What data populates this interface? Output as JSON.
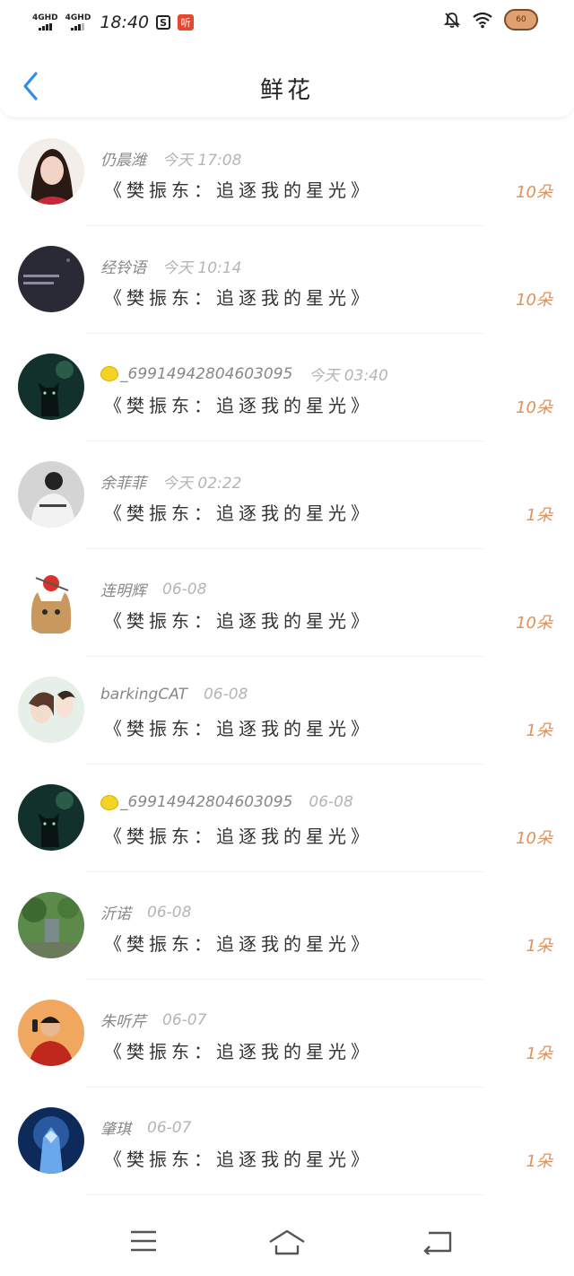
{
  "status_bar": {
    "network1": "4GHD",
    "network2": "4GHD",
    "time": "18:40",
    "icon_s": "S",
    "icon_ting": "听",
    "battery_level": "60"
  },
  "nav": {
    "title": "鲜花"
  },
  "records": [
    {
      "name": "仍晨潍",
      "time": "今天 17:08",
      "book": "《樊振东：追逐我的星光》",
      "count": "10朵",
      "lemon": false,
      "avatar": "girl"
    },
    {
      "name": "经铃语",
      "time": "今天 10:14",
      "book": "《樊振东：追逐我的星光》",
      "count": "10朵",
      "lemon": false,
      "avatar": "dark-text"
    },
    {
      "name": "_69914942804603095",
      "time": "今天 03:40",
      "book": "《樊振东：追逐我的星光》",
      "count": "10朵",
      "lemon": true,
      "avatar": "cat-night"
    },
    {
      "name": "余菲菲",
      "time": "今天 02:22",
      "book": "《樊振东：追逐我的星光》",
      "count": "1朵",
      "lemon": false,
      "avatar": "gray-person"
    },
    {
      "name": "连明辉",
      "time": "06-08",
      "book": "《樊振东：追逐我的星光》",
      "count": "10朵",
      "lemon": false,
      "avatar": "cat-apple"
    },
    {
      "name": "barkingCAT",
      "time": "06-08",
      "book": "《樊振东：追逐我的星光》",
      "count": "1朵",
      "lemon": false,
      "avatar": "couple"
    },
    {
      "name": "_69914942804603095",
      "time": "06-08",
      "book": "《樊振东：追逐我的星光》",
      "count": "10朵",
      "lemon": true,
      "avatar": "cat-night"
    },
    {
      "name": "沂诺",
      "time": "06-08",
      "book": "《樊振东：追逐我的星光》",
      "count": "1朵",
      "lemon": false,
      "avatar": "garden"
    },
    {
      "name": "朱听芹",
      "time": "06-07",
      "book": "《樊振东：追逐我的星光》",
      "count": "1朵",
      "lemon": false,
      "avatar": "boy-red"
    },
    {
      "name": "肇琪",
      "time": "06-07",
      "book": "《樊振东：追逐我的星光》",
      "count": "1朵",
      "lemon": false,
      "avatar": "knight"
    }
  ],
  "colors": {
    "accent_blue": "#2f8ee8",
    "count_orange": "#e0915a"
  },
  "icons": {
    "back": "chevron-left-icon",
    "menu": "menu-icon",
    "home": "home-icon",
    "return": "return-icon"
  }
}
